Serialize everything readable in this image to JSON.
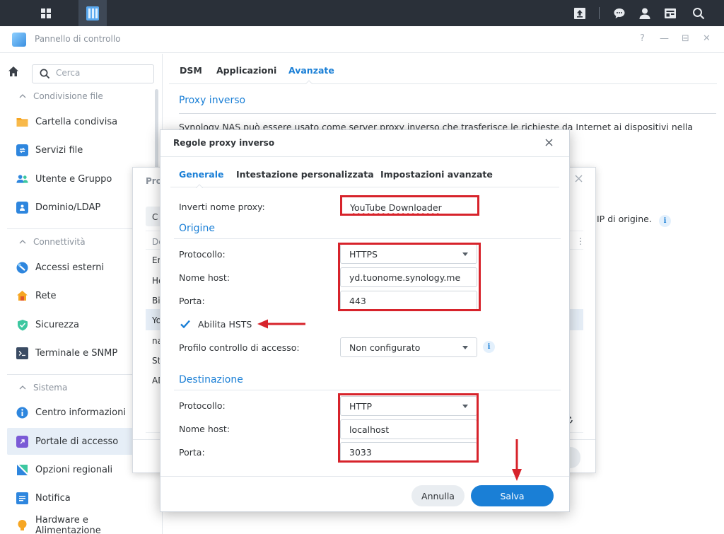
{
  "window": {
    "title": "Pannello di controllo",
    "controls": [
      "?",
      "—",
      "⊟",
      "✕"
    ]
  },
  "colors": {
    "accent": "#1a7fd6",
    "taskbar": "#2a3039",
    "highlight_red": "#d7232b"
  },
  "sidebar": {
    "search_placeholder": "Cerca",
    "sections": [
      {
        "title": "Condivisione file",
        "items": [
          {
            "label": "Cartella condivisa",
            "icon": "folder-icon"
          },
          {
            "label": "Servizi file",
            "icon": "file-services-icon"
          },
          {
            "label": "Utente e Gruppo",
            "icon": "users-icon"
          },
          {
            "label": "Dominio/LDAP",
            "icon": "domain-icon"
          }
        ]
      },
      {
        "title": "Connettività",
        "items": [
          {
            "label": "Accessi esterni",
            "icon": "external-access-icon"
          },
          {
            "label": "Rete",
            "icon": "network-icon"
          },
          {
            "label": "Sicurezza",
            "icon": "shield-icon"
          },
          {
            "label": "Terminale e SNMP",
            "icon": "terminal-icon"
          }
        ]
      },
      {
        "title": "Sistema",
        "items": [
          {
            "label": "Centro informazioni",
            "icon": "info-center-icon"
          },
          {
            "label": "Portale di accesso",
            "icon": "login-portal-icon",
            "active": true
          },
          {
            "label": "Opzioni regionali",
            "icon": "regional-icon"
          },
          {
            "label": "Notifica",
            "icon": "notification-icon"
          },
          {
            "label": "Hardware e Alimentazione",
            "icon": "hardware-icon"
          }
        ]
      }
    ]
  },
  "main": {
    "tabs": [
      "DSM",
      "Applicazioni",
      "Avanzate"
    ],
    "active_tab": "Avanzate",
    "section_title": "Proxy inverso",
    "description": "Synology NAS può essere usato come server proxy inverso che trasferisce le richieste da Internet ai dispositivi nella",
    "ip_text": "IP di origine."
  },
  "bg_dialog": {
    "title_fragment": "Pro",
    "button_fragment": "C",
    "rows": [
      "De",
      "En",
      "He",
      "Bi",
      "Yo",
      "na",
      "St",
      "AD"
    ]
  },
  "dialog": {
    "title": "Regole proxy inverso",
    "tabs": [
      "Generale",
      "Intestazione personalizzata",
      "Impostazioni avanzate"
    ],
    "active_tab": "Generale",
    "proxy_name_label": "Inverti nome proxy:",
    "proxy_name_value": "YouTube Downloader",
    "origin": {
      "title": "Origine",
      "protocol_label": "Protocollo:",
      "protocol_value": "HTTPS",
      "hostname_label": "Nome host:",
      "hostname_value": "yd.tuonome.synology.me",
      "port_label": "Porta:",
      "port_value": "443",
      "hsts_label": "Abilita HSTS",
      "hsts_checked": true,
      "acl_label": "Profilo controllo di accesso:",
      "acl_value": "Non configurato"
    },
    "destination": {
      "title": "Destinazione",
      "protocol_label": "Protocollo:",
      "protocol_value": "HTTP",
      "hostname_label": "Nome host:",
      "hostname_value": "localhost",
      "port_label": "Porta:",
      "port_value": "3033"
    },
    "cancel_label": "Annulla",
    "save_label": "Salva"
  }
}
